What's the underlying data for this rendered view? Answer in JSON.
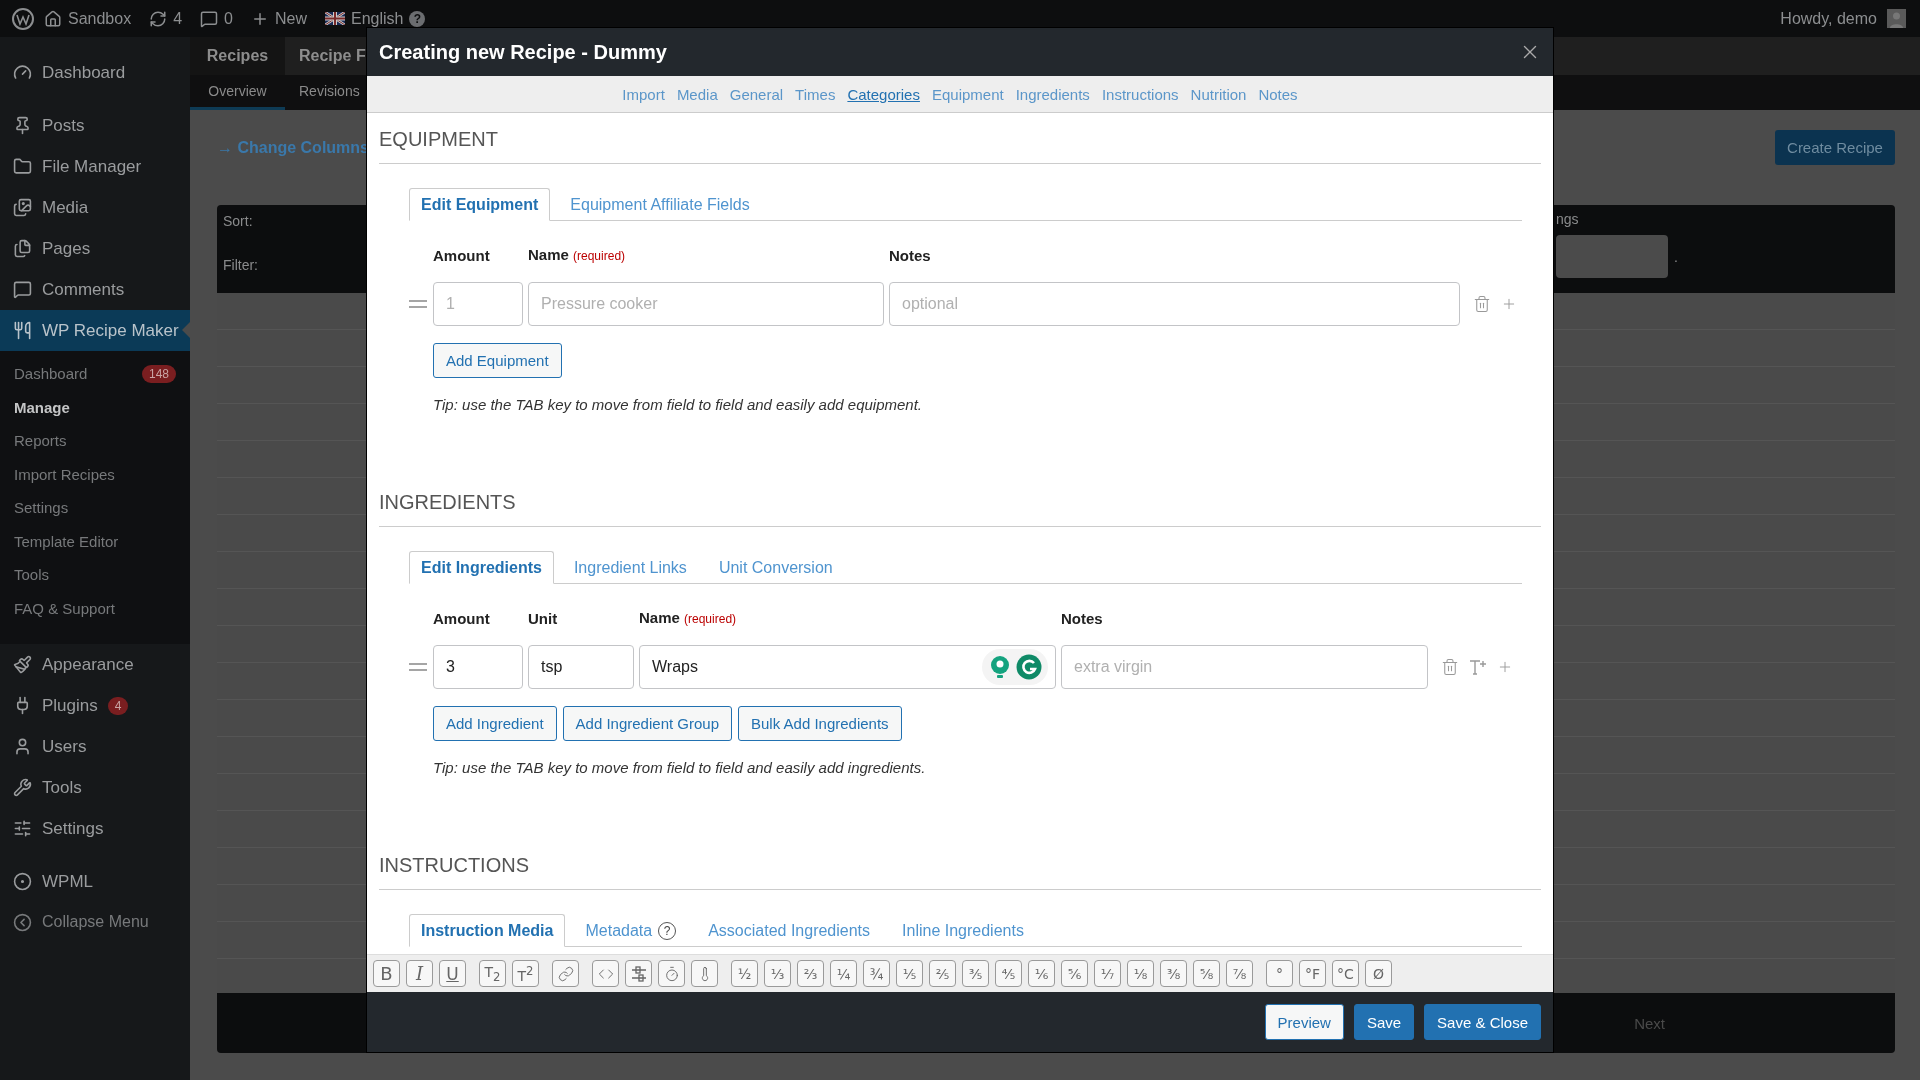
{
  "admin_bar": {
    "site": "Sandbox",
    "updates": "4",
    "comments": "0",
    "new": "New",
    "language": "English",
    "help": "?",
    "greeting": "Howdy, demo"
  },
  "sidebar": {
    "groups": [
      {
        "items": [
          {
            "label": "Dashboard",
            "selected": false
          }
        ]
      },
      {
        "items": [
          {
            "label": "Posts",
            "selected": false
          },
          {
            "label": "File Manager",
            "selected": false
          },
          {
            "label": "Media",
            "selected": false
          },
          {
            "label": "Pages",
            "selected": false
          },
          {
            "label": "Comments",
            "selected": false
          },
          {
            "label": "WP Recipe Maker",
            "selected": true,
            "children": [
              {
                "label": "Dashboard",
                "badge": "148",
                "selected": false
              },
              {
                "label": "Manage",
                "selected": true
              },
              {
                "label": "Reports",
                "selected": false
              },
              {
                "label": "Import Recipes",
                "selected": false
              },
              {
                "label": "Settings",
                "selected": false
              },
              {
                "label": "Template Editor",
                "selected": false
              },
              {
                "label": "Tools",
                "selected": false
              },
              {
                "label": "FAQ & Support",
                "selected": false
              }
            ]
          },
          {
            "label": "Appearance",
            "selected": false
          },
          {
            "label": "Plugins",
            "badge": "4",
            "selected": false
          },
          {
            "label": "Users",
            "selected": false
          },
          {
            "label": "Tools",
            "selected": false
          },
          {
            "label": "Settings",
            "selected": false
          }
        ]
      },
      {
        "items": [
          {
            "label": "WPML",
            "selected": false
          }
        ]
      }
    ],
    "collapse": "Collapse Menu"
  },
  "page": {
    "tabs": [
      {
        "label": "Recipes",
        "selected": true
      },
      {
        "label": "Recipe F",
        "selected": false
      }
    ],
    "subtabs": [
      {
        "label": "Overview",
        "selected": true
      },
      {
        "label": "Revisions",
        "selected": false
      }
    ],
    "change_columns": "→ Change Columns",
    "create_button": "Create Recipe",
    "table": {
      "sort": "Sort:",
      "filter": "Filter:",
      "header_fragment": "ngs",
      "field_fragment": ".",
      "next": "Next"
    }
  },
  "modal": {
    "title": "Creating new Recipe - Dummy",
    "nav": [
      {
        "label": "Import",
        "selected": false
      },
      {
        "label": "Media",
        "selected": false
      },
      {
        "label": "General",
        "selected": false
      },
      {
        "label": "Times",
        "selected": false
      },
      {
        "label": "Categories",
        "selected": true
      },
      {
        "label": "Equipment",
        "selected": false
      },
      {
        "label": "Ingredients",
        "selected": false
      },
      {
        "label": "Instructions",
        "selected": false
      },
      {
        "label": "Nutrition",
        "selected": false
      },
      {
        "label": "Notes",
        "selected": false
      }
    ],
    "sections": [
      {
        "kind": "equipment",
        "heading": "EQUIPMENT",
        "tabs": [
          {
            "label": "Edit Equipment",
            "selected": true
          },
          {
            "label": "Equipment Affiliate Fields",
            "selected": false
          }
        ],
        "columns": [
          {
            "label": "Amount"
          },
          {
            "label": "Name",
            "note": "(required)"
          },
          {
            "label": "Notes"
          }
        ],
        "fields": [
          {
            "placeholder": "1"
          },
          {
            "placeholder": "Pressure cooker"
          },
          {
            "placeholder": "optional"
          }
        ],
        "buttons": [
          "Add Equipment"
        ],
        "tip": "Tip: use the TAB key to move from field to field and easily add equipment."
      },
      {
        "kind": "ingredients",
        "heading": "INGREDIENTS",
        "tabs": [
          {
            "label": "Edit Ingredients",
            "selected": true
          },
          {
            "label": "Ingredient Links",
            "selected": false
          },
          {
            "label": "Unit Conversion",
            "selected": false
          }
        ],
        "columns": [
          {
            "label": "Amount"
          },
          {
            "label": "Unit"
          },
          {
            "label": "Name",
            "note": "(required)"
          },
          {
            "label": "Notes"
          }
        ],
        "fields": [
          {
            "value": "3"
          },
          {
            "value": "tsp"
          },
          {
            "value": "Wraps",
            "assistant": true
          },
          {
            "placeholder": "extra virgin"
          }
        ],
        "buttons": [
          "Add Ingredient",
          "Add Ingredient Group",
          "Bulk Add Ingredients"
        ],
        "tip": "Tip: use the TAB key to move from field to field and easily add ingredients."
      },
      {
        "kind": "instructions",
        "heading": "INSTRUCTIONS",
        "tabs": [
          {
            "label": "Instruction Media",
            "selected": true
          },
          {
            "label": "Metadata",
            "help": "?",
            "selected": false
          },
          {
            "label": "Associated Ingredients",
            "selected": false
          },
          {
            "label": "Inline Ingredients",
            "selected": false
          }
        ]
      }
    ],
    "toolbar": [
      {
        "kind": "text",
        "items": [
          "B",
          "I",
          "U"
        ]
      },
      {
        "kind": "text",
        "items": [
          "T$_{2}$",
          "T$^{2}$"
        ]
      },
      {
        "kind": "link"
      },
      {
        "kind": "tools"
      },
      {
        "kind": "text",
        "items": [
          "½",
          "⅓",
          "⅔",
          "¼",
          "¾",
          "⅕",
          "⅖",
          "⅗",
          "⅘",
          "⅙",
          "⅚",
          "⅐",
          "⅛",
          "⅜",
          "⅝",
          "⅞"
        ]
      },
      {
        "kind": "text",
        "items": [
          "°",
          "°F",
          "°C",
          "Ø"
        ]
      }
    ],
    "footer_buttons": [
      {
        "label": "Preview",
        "kind": "secondary"
      },
      {
        "label": "Save",
        "kind": "primary"
      },
      {
        "label": "Save & Close",
        "kind": "primary"
      }
    ]
  }
}
